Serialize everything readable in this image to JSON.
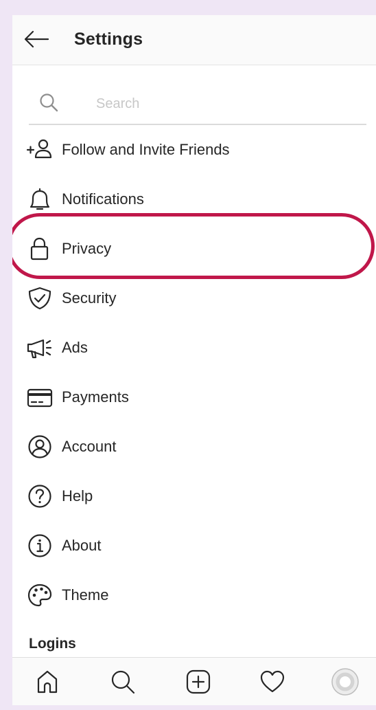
{
  "header": {
    "title": "Settings",
    "back_icon": "arrow-left-icon"
  },
  "search": {
    "placeholder": "Search",
    "value": "",
    "icon": "search-icon"
  },
  "menu": [
    {
      "id": "follow-invite",
      "label": "Follow and Invite Friends",
      "icon": "add-person-icon"
    },
    {
      "id": "notifications",
      "label": "Notifications",
      "icon": "bell-icon"
    },
    {
      "id": "privacy",
      "label": "Privacy",
      "icon": "lock-icon",
      "highlighted": true
    },
    {
      "id": "security",
      "label": "Security",
      "icon": "shield-check-icon"
    },
    {
      "id": "ads",
      "label": "Ads",
      "icon": "megaphone-icon"
    },
    {
      "id": "payments",
      "label": "Payments",
      "icon": "credit-card-icon"
    },
    {
      "id": "account",
      "label": "Account",
      "icon": "account-circle-icon"
    },
    {
      "id": "help",
      "label": "Help",
      "icon": "help-circle-icon"
    },
    {
      "id": "about",
      "label": "About",
      "icon": "info-circle-icon"
    },
    {
      "id": "theme",
      "label": "Theme",
      "icon": "palette-icon"
    }
  ],
  "section": {
    "logins": "Logins"
  },
  "tabbar": [
    {
      "id": "home",
      "icon": "home-icon"
    },
    {
      "id": "search",
      "icon": "search-icon"
    },
    {
      "id": "create",
      "icon": "add-post-icon"
    },
    {
      "id": "activity",
      "icon": "heart-icon"
    },
    {
      "id": "profile",
      "icon": "profile-avatar-icon"
    }
  ],
  "colors": {
    "highlight": "#c0174a",
    "background": "#efe6f5",
    "text": "#262626"
  }
}
